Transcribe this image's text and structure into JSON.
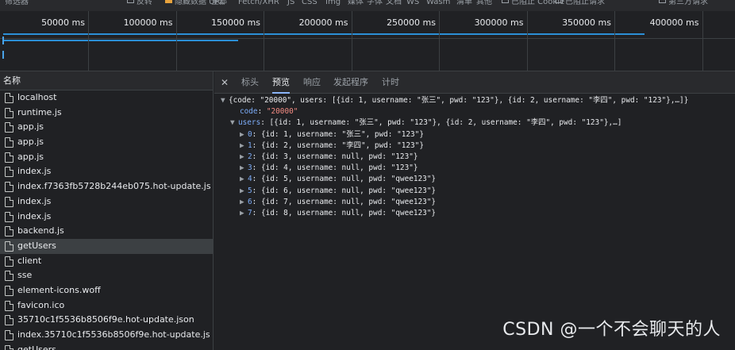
{
  "filterbar": {
    "items": [
      {
        "label": "筛选器",
        "checkbox": false
      },
      {
        "label": "反转",
        "checkbox": true,
        "checked": false
      },
      {
        "label": "隐藏数据 URL",
        "checkbox": true,
        "checked": true
      },
      {
        "label": "全部",
        "checkbox": false
      },
      {
        "label": "Fetch/XHR",
        "checkbox": false
      },
      {
        "label": "JS",
        "checkbox": false
      },
      {
        "label": "CSS",
        "checkbox": false
      },
      {
        "label": "Img",
        "checkbox": false
      },
      {
        "label": "媒体",
        "checkbox": false
      },
      {
        "label": "字体",
        "checkbox": false
      },
      {
        "label": "文档",
        "checkbox": false
      },
      {
        "label": "WS",
        "checkbox": false
      },
      {
        "label": "Wasm",
        "checkbox": false
      },
      {
        "label": "清单",
        "checkbox": false
      },
      {
        "label": "其他",
        "checkbox": false
      },
      {
        "label": "已阻止 Cookie",
        "checkbox": true,
        "checked": false
      },
      {
        "label": "已阻止请求",
        "checkbox": true,
        "checked": false
      },
      {
        "label": "第三方请求",
        "checkbox": true,
        "checked": false
      }
    ]
  },
  "timeline": {
    "ticks": [
      "50000 ms",
      "100000 ms",
      "150000 ms",
      "200000 ms",
      "250000 ms",
      "300000 ms",
      "350000 ms",
      "400000 ms"
    ]
  },
  "requests": {
    "header": "名称",
    "selected_index": 10,
    "items": [
      "localhost",
      "runtime.js",
      "app.js",
      "app.js",
      "app.js",
      "index.js",
      "index.f7363fb5728b244eb075.hot-update.js",
      "index.js",
      "index.js",
      "backend.js",
      "getUsers",
      "client",
      "sse",
      "element-icons.woff",
      "favicon.ico",
      "35710c1f5536b8506f9e.hot-update.json",
      "index.35710c1f5536b8506f9e.hot-update.js",
      "getUsers"
    ]
  },
  "details": {
    "tabs": [
      "标头",
      "预览",
      "响应",
      "发起程序",
      "计时"
    ],
    "active_tab": 1,
    "preview": {
      "summary": "{code: \"20000\", users: [{id: 1, username: \"张三\", pwd: \"123\"}, {id: 2, username: \"李四\", pwd: \"123\"},…]}",
      "code_key": "code",
      "code_value": "\"20000\"",
      "users_key": "users",
      "users_summary": "[{id: 1, username: \"张三\", pwd: \"123\"}, {id: 2, username: \"李四\", pwd: \"123\"},…]",
      "users": [
        {
          "index": "0",
          "text": "{id: 1, username: \"张三\", pwd: \"123\"}"
        },
        {
          "index": "1",
          "text": "{id: 2, username: \"李四\", pwd: \"123\"}"
        },
        {
          "index": "2",
          "text": "{id: 3, username: null, pwd: \"123\"}"
        },
        {
          "index": "3",
          "text": "{id: 4, username: null, pwd: \"123\"}"
        },
        {
          "index": "4",
          "text": "{id: 5, username: null, pwd: \"qwee123\"}"
        },
        {
          "index": "5",
          "text": "{id: 6, username: null, pwd: \"qwee123\"}"
        },
        {
          "index": "6",
          "text": "{id: 7, username: null, pwd: \"qwee123\"}"
        },
        {
          "index": "7",
          "text": "{id: 8, username: null, pwd: \"qwee123\"}"
        }
      ]
    }
  },
  "watermark": "CSDN @一个不会聊天的人"
}
